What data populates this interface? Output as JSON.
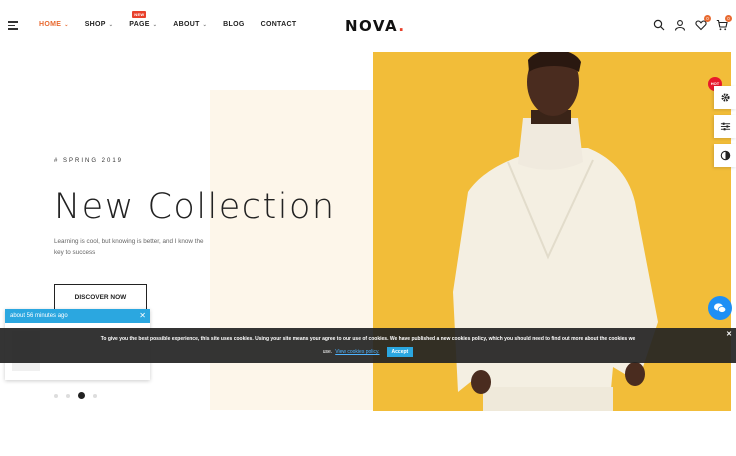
{
  "header": {
    "nav": [
      {
        "label": "HOME",
        "active": true,
        "dropdown": true
      },
      {
        "label": "SHOP",
        "active": false,
        "dropdown": true
      },
      {
        "label": "PAGE",
        "active": false,
        "dropdown": true,
        "badge": "NEW"
      },
      {
        "label": "ABOUT",
        "active": false,
        "dropdown": true
      },
      {
        "label": "BLOG",
        "active": false,
        "dropdown": false
      },
      {
        "label": "CONTACT",
        "active": false,
        "dropdown": false
      }
    ],
    "logo": "NOVA",
    "logo_dot": ".",
    "wishlist_count": "0",
    "cart_count": "0"
  },
  "hero": {
    "subtitle": "# SPRING 2019",
    "headline": "New Collection",
    "description": "Learning is cool, but knowing is better, and I know the key to success",
    "cta": "DISCOVER NOW",
    "active_slide": 3,
    "slide_count": 4
  },
  "side_tools": {
    "hot_badge": "HOT",
    "icons": [
      "gear-icon",
      "sliders-icon",
      "contrast-icon"
    ]
  },
  "notification": {
    "time": "about 56 minutes ago"
  },
  "cookie": {
    "message": "To give you the best possible experience, this site uses cookies. Using your site means your agree to our use of cookies. We have published a new cookies policy, which you should need to find out more about the cookies we",
    "use_text": "use.",
    "link_text": "View cookies policy.",
    "accept": "Accept"
  },
  "colors": {
    "accent": "#e8692f",
    "photo_bg": "#f2bd39",
    "cookie_button": "#2ba7e0"
  }
}
